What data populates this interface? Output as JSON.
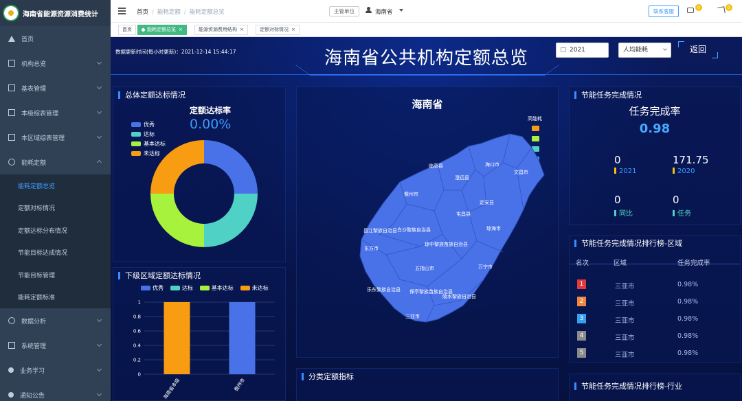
{
  "app": {
    "title": "海南省能源资源消费统计"
  },
  "sidebar": {
    "items": [
      {
        "label": "首页"
      },
      {
        "label": "机构总览"
      },
      {
        "label": "基表管理"
      },
      {
        "label": "本级综表管理"
      },
      {
        "label": "本区域综表管理"
      },
      {
        "label": "能耗定额"
      }
    ],
    "subitems": [
      {
        "label": "能耗定额总览"
      },
      {
        "label": "定额对标情况"
      },
      {
        "label": "定额达标分布情况"
      },
      {
        "label": "节能目标达成情况"
      },
      {
        "label": "节能目标管理"
      },
      {
        "label": "能耗定额标准"
      }
    ],
    "lower_items": [
      {
        "label": "数据分析"
      },
      {
        "label": "系统管理"
      },
      {
        "label": "业务学习"
      },
      {
        "label": "通知公告"
      }
    ]
  },
  "topbar": {
    "breadcrumb": [
      "首页",
      "能耗定额",
      "能耗定额总览"
    ],
    "unit_button": "主管单位",
    "user_name": "海南省",
    "contact_button": "联系客服",
    "msg_badge": "0",
    "notice_badge": "0"
  },
  "tabs": [
    {
      "label": "首页"
    },
    {
      "label": "能耗定额总览"
    },
    {
      "label": "能源资源费用结构"
    },
    {
      "label": "定额对标情况"
    }
  ],
  "dashboard": {
    "update_time": "数据更新时间(每小时更新)：2021-12-14 15:44:17",
    "title": "海南省公共机构定额总览",
    "year_select": "2021",
    "metric_select": "人均能耗",
    "back_button": "返回"
  },
  "colors": {
    "excellent": "#4a72e8",
    "pass": "#4fd1c5",
    "basic": "#a7f23c",
    "fail": "#f89c12"
  },
  "quota_panel": {
    "title": "总体定额达标情况",
    "rate_label": "定额达标率",
    "rate_value": "0.00%",
    "legend": [
      "优秀",
      "达标",
      "基本达标",
      "未达标"
    ]
  },
  "sub_region_panel": {
    "title": "下级区域定额达标情况",
    "legend": [
      "优秀",
      "达标",
      "基本达标",
      "未达标"
    ]
  },
  "chart_data": [
    {
      "type": "pie",
      "labels": [
        "优秀",
        "达标",
        "基本达标",
        "未达标"
      ],
      "values": [
        25,
        25,
        25,
        25
      ],
      "title": "定额达标率"
    },
    {
      "type": "bar",
      "categories": [
        "海南省本级",
        "儋州市"
      ],
      "series": [
        {
          "name": "优秀",
          "values": [
            0,
            1
          ]
        },
        {
          "name": "达标",
          "values": [
            0,
            0
          ]
        },
        {
          "name": "基本达标",
          "values": [
            0,
            0
          ]
        },
        {
          "name": "未达标",
          "values": [
            1,
            0
          ]
        }
      ],
      "ylim": [
        0,
        1
      ],
      "yticks": [
        "0",
        "0.2",
        "0.4",
        "0.6",
        "0.8",
        "1"
      ],
      "grid": true,
      "legend": "top"
    }
  ],
  "map": {
    "title": "海南省",
    "legend_label": "高能耗",
    "legend_colors": [
      "#f89c12",
      "#a7f23c",
      "#4fd1c5",
      "#3aa3ff"
    ],
    "regions": [
      "临高县",
      "海口市",
      "文昌市",
      "澄迈县",
      "儋州市",
      "定安县",
      "屯昌县",
      "昌江黎族自治县",
      "白沙黎族自治县",
      "琼海市",
      "琼中黎族苗族自治县",
      "东方市",
      "五指山市",
      "万宁市",
      "乐东黎族自治县",
      "保亭黎族苗族自治县",
      "陵水黎族自治县",
      "三亚市"
    ],
    "region_labels": [
      "临高县",
      "海口市",
      "文昌市",
      "澄迈县",
      "儋州市",
      "定安县",
      "屯昌县",
      "昌江黎族自治县",
      "白沙黎族自治县",
      "琼海市",
      "琼中黎族苗族自治县",
      "东方市",
      "五指山市",
      "万宁市",
      "乐东黎族自治县",
      "保亭黎族苗族自治县",
      "陵水黎族自治县",
      "三亚市"
    ]
  },
  "category_panel": {
    "title": "分类定额指标"
  },
  "task_panel": {
    "title": "节能任务完成情况",
    "rate_title": "任务完成率",
    "rate_value": "0.98",
    "stats": [
      {
        "value": "0",
        "label": "2021"
      },
      {
        "value": "171.75",
        "label": "2020"
      },
      {
        "value": "0",
        "label": "同比"
      },
      {
        "value": "0",
        "label": "任务"
      }
    ]
  },
  "ranking_region": {
    "title": "节能任务完成情况排行榜-区域",
    "headers": [
      "名次",
      "区域",
      "任务完成率"
    ],
    "rows": [
      {
        "rank": "1",
        "name": "三亚市",
        "rate": "0.98%",
        "color": "#e0393e"
      },
      {
        "rank": "2",
        "name": "三亚市",
        "rate": "0.98%",
        "color": "#ef8743"
      },
      {
        "rank": "3",
        "name": "三亚市",
        "rate": "0.98%",
        "color": "#39a0f0"
      },
      {
        "rank": "4",
        "name": "三亚市",
        "rate": "0.98%",
        "color": "#8b8b8b"
      },
      {
        "rank": "5",
        "name": "三亚市",
        "rate": "0.98%",
        "color": "#8b8b8b"
      }
    ]
  },
  "ranking_industry": {
    "title": "节能任务完成情况排行榜-行业"
  }
}
